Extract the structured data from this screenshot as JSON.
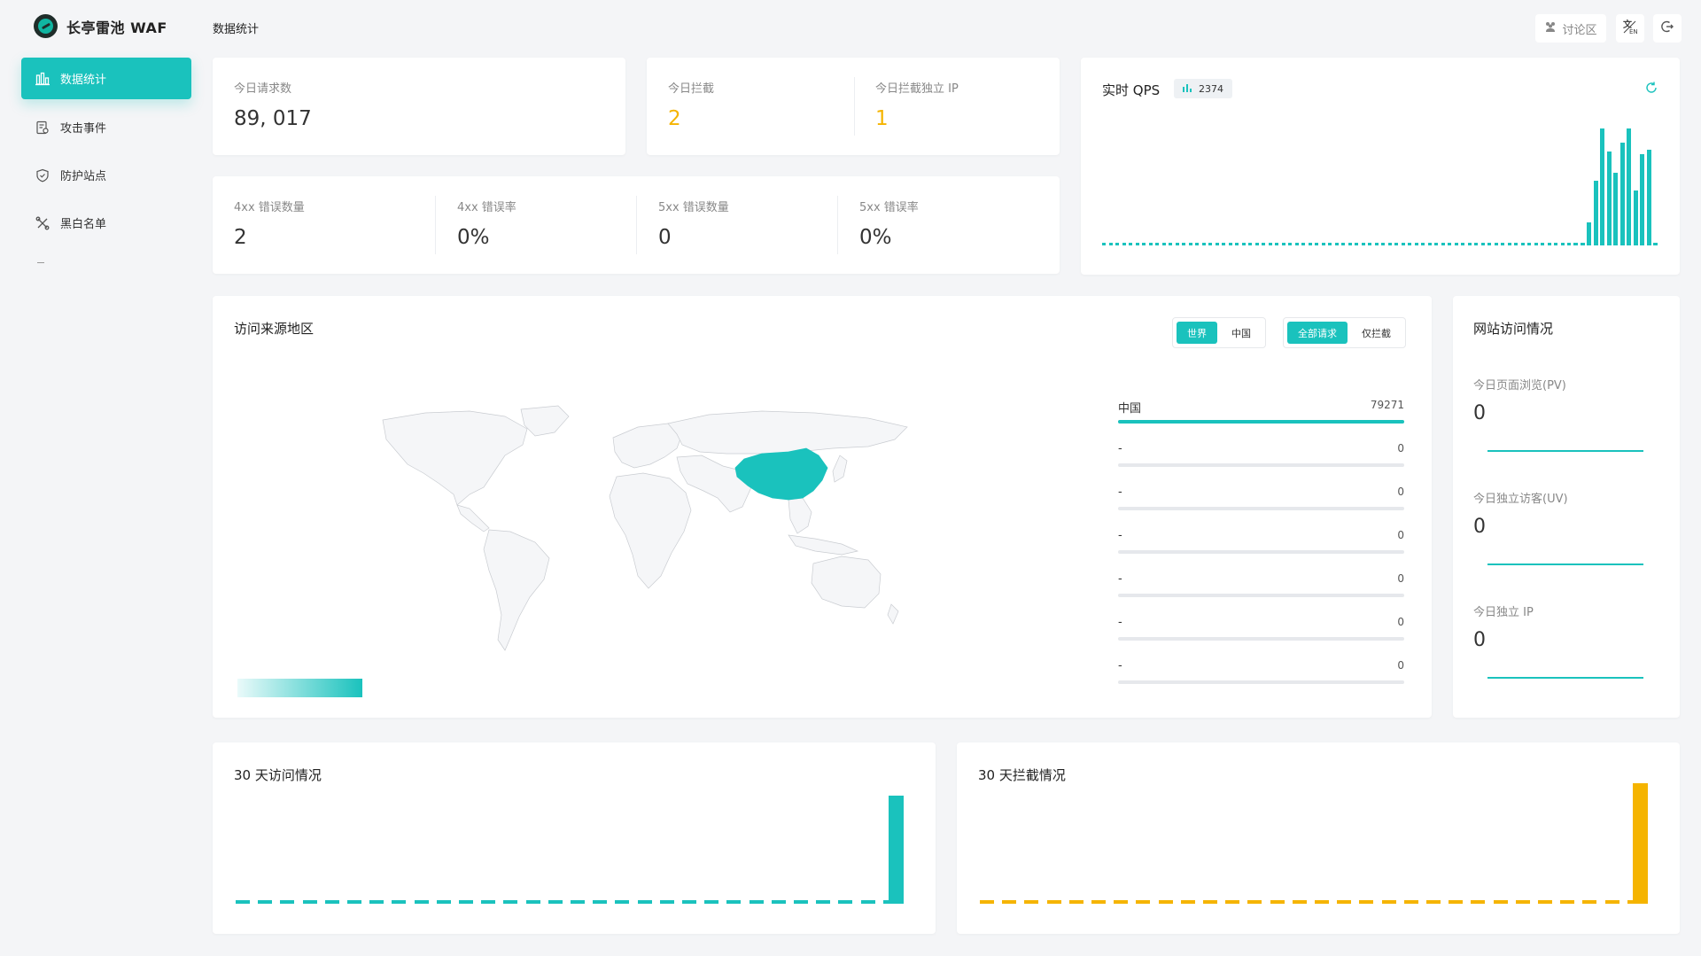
{
  "brand": {
    "name": "长亭雷池 WAF"
  },
  "sidebar": {
    "items": [
      {
        "label": "数据统计",
        "icon": "bar-chart-icon",
        "active": true
      },
      {
        "label": "攻击事件",
        "icon": "event-log-icon",
        "active": false
      },
      {
        "label": "防护站点",
        "icon": "shield-icon",
        "active": false
      },
      {
        "label": "黑白名单",
        "icon": "tools-icon",
        "active": false
      }
    ]
  },
  "header": {
    "title": "数据统计",
    "forum_label": "讨论区",
    "forum_icon": "community-icon",
    "lang_icon": "language-icon",
    "logout_icon": "logout-icon"
  },
  "stats": {
    "requests": {
      "label": "今日请求数",
      "value": "89, 017"
    },
    "blocked": {
      "label": "今日拦截",
      "value": "2"
    },
    "blocked_ip": {
      "label": "今日拦截独立 IP",
      "value": "1"
    },
    "err4xx_count": {
      "label": "4xx 错误数量",
      "value": "2"
    },
    "err4xx_rate": {
      "label": "4xx 错误率",
      "value": "0%"
    },
    "err5xx_count": {
      "label": "5xx 错误数量",
      "value": "0"
    },
    "err5xx_rate": {
      "label": "5xx 错误率",
      "value": "0%"
    }
  },
  "qps": {
    "title": "实时 QPS",
    "badge_value": "2374",
    "badge_icon": "bar-chart-icon",
    "refresh_icon": "refresh-icon",
    "series_tail": [
      0.02,
      0.02,
      0.2,
      0.55,
      1.0,
      0.8,
      0.62,
      0.88,
      1.0,
      0.47,
      0.78,
      0.82,
      0.0
    ],
    "color": "#1ac2bd"
  },
  "geo": {
    "title": "访问来源地区",
    "scope_options": [
      "世界",
      "中国"
    ],
    "scope_selected": "世界",
    "filter_options": [
      "全部请求",
      "仅拦截"
    ],
    "filter_selected": "全部请求",
    "ranking": [
      {
        "name": "中国",
        "value": "79271",
        "fraction": 1.0
      },
      {
        "name": "-",
        "value": "0",
        "fraction": 0
      },
      {
        "name": "-",
        "value": "0",
        "fraction": 0
      },
      {
        "name": "-",
        "value": "0",
        "fraction": 0
      },
      {
        "name": "-",
        "value": "0",
        "fraction": 0
      },
      {
        "name": "-",
        "value": "0",
        "fraction": 0
      },
      {
        "name": "-",
        "value": "0",
        "fraction": 0
      }
    ],
    "highlight_color": "#1ac2bd"
  },
  "site_visits": {
    "title": "网站访问情况",
    "pv": {
      "label": "今日页面浏览(PV)",
      "value": "0"
    },
    "uv": {
      "label": "今日独立访客(UV)",
      "value": "0"
    },
    "ip": {
      "label": "今日独立 IP",
      "value": "0"
    }
  },
  "trend_visits": {
    "title": "30 天访问情况",
    "color": "#1ac2bd",
    "last_value_fraction": 1.0
  },
  "trend_blocks": {
    "title": "30 天拦截情况",
    "color": "#f5b400",
    "last_value_fraction": 1.0
  }
}
